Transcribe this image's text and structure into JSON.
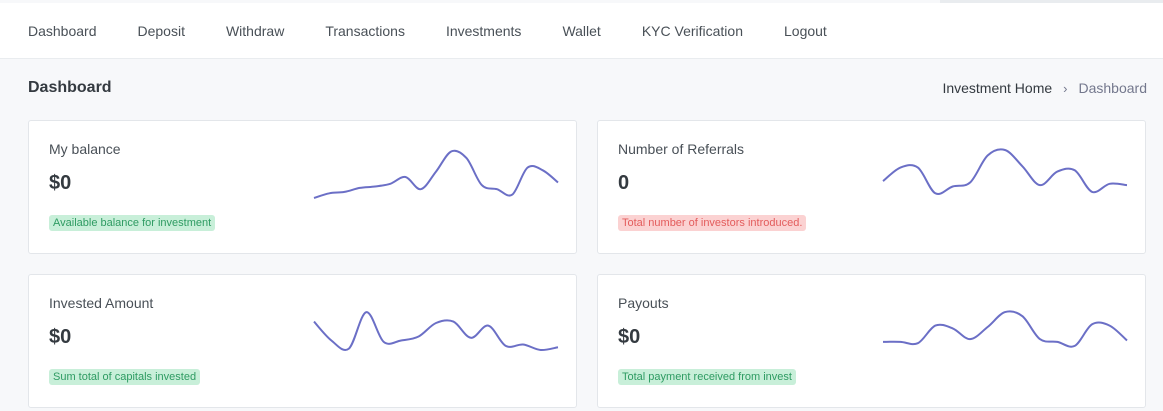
{
  "nav": {
    "items": [
      "Dashboard",
      "Deposit",
      "Withdraw",
      "Transactions",
      "Investments",
      "Wallet",
      "KYC Verification",
      "Logout"
    ]
  },
  "page": {
    "title": "Dashboard",
    "breadcrumb": {
      "parent": "Investment Home",
      "separator": "›",
      "current": "Dashboard"
    }
  },
  "cards": [
    {
      "title": "My balance",
      "value": "$0",
      "badge": "Available balance for investment",
      "badge_color": "green",
      "spark": [
        3,
        10,
        12,
        18,
        20,
        24,
        34,
        16,
        42,
        72,
        62,
        22,
        16,
        8,
        48,
        44,
        26
      ]
    },
    {
      "title": "Number of Referrals",
      "value": "0",
      "badge": "Total number of investors introduced.",
      "badge_color": "red",
      "spark": [
        28,
        48,
        48,
        10,
        20,
        26,
        66,
        74,
        50,
        22,
        42,
        44,
        12,
        24,
        22
      ]
    },
    {
      "title": "Invested Amount",
      "value": "$0",
      "badge": "Sum total of capitals invested",
      "badge_color": "green",
      "spark": [
        48,
        20,
        8,
        62,
        18,
        20,
        26,
        46,
        48,
        24,
        42,
        12,
        14,
        6,
        10
      ]
    },
    {
      "title": "Payouts",
      "value": "$0",
      "badge": "Total payment received from invest",
      "badge_color": "green",
      "spark": [
        18,
        18,
        16,
        42,
        38,
        22,
        40,
        62,
        56,
        22,
        18,
        12,
        44,
        42,
        20
      ]
    }
  ],
  "colors": {
    "spark_line": "#6b6fc6",
    "badge_green_bg": "#c8efd9",
    "badge_red_bg": "#fbd2d2"
  }
}
